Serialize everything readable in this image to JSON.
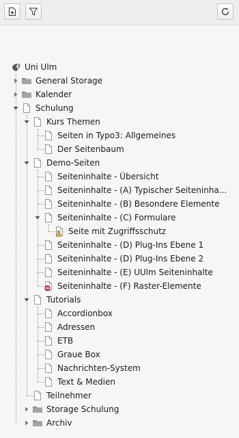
{
  "toolbar": {
    "new_page": {
      "icon": "new-page-icon"
    },
    "filter": {
      "icon": "filter-icon"
    },
    "refresh": {
      "icon": "refresh-icon"
    }
  },
  "tree": {
    "root": {
      "label": "Uni Ulm",
      "icon": "typo3-logo-icon"
    },
    "general_storage": {
      "label": "General Storage",
      "icon": "folder-icon",
      "state": "collapsed"
    },
    "kalender": {
      "label": "Kalender",
      "icon": "folder-icon",
      "state": "collapsed"
    },
    "schulung": {
      "label": "Schulung",
      "icon": "page-icon",
      "state": "expanded"
    },
    "kurs_themen": {
      "label": "Kurs Themen",
      "icon": "page-icon",
      "state": "expanded"
    },
    "seiten_typo3": {
      "label": "Seiten in Typo3: Allgemeines",
      "icon": "page-icon"
    },
    "seitenbaum": {
      "label": "Der Seitenbaum",
      "icon": "page-icon"
    },
    "demo_seiten": {
      "label": "Demo-Seiten",
      "icon": "page-icon",
      "state": "expanded"
    },
    "si_uebersicht": {
      "label": "Seiteninhalte - Übersicht",
      "icon": "page-icon"
    },
    "si_a": {
      "label": "Seiteninhalte - (A) Typischer Seiteninha...",
      "icon": "page-icon"
    },
    "si_b": {
      "label": "Seiteninhalte - (B) Besondere Elemente",
      "icon": "page-icon"
    },
    "si_c": {
      "label": "Seiteninhalte - (C) Formulare",
      "icon": "page-icon",
      "state": "expanded"
    },
    "zugriffsschutz": {
      "label": "Seite mit Zugriffsschutz",
      "icon": "protected-page-icon"
    },
    "si_d1": {
      "label": "Seiteninhalte - (D) Plug-Ins Ebene 1",
      "icon": "page-icon"
    },
    "si_d2": {
      "label": "Seiteninhalte - (D) Plug-Ins Ebene 2",
      "icon": "page-icon"
    },
    "si_e": {
      "label": "Seiteninhalte - (E) UUlm Seiteninhalte",
      "icon": "page-icon"
    },
    "si_f": {
      "label": "Seiteninhalte - (F) Raster-Elemente",
      "icon": "hidden-page-icon"
    },
    "tutorials": {
      "label": "Tutorials",
      "icon": "page-icon",
      "state": "expanded"
    },
    "accordionbox": {
      "label": "Accordionbox",
      "icon": "page-icon"
    },
    "adressen": {
      "label": "Adressen",
      "icon": "page-icon"
    },
    "etb": {
      "label": "ETB",
      "icon": "page-icon"
    },
    "graue_box": {
      "label": "Graue Box",
      "icon": "page-icon"
    },
    "nachrichten": {
      "label": "Nachrichten-System",
      "icon": "page-icon"
    },
    "text_medien": {
      "label": "Text & Medien",
      "icon": "page-icon"
    },
    "teilnehmer": {
      "label": "Teilnehmer",
      "icon": "page-icon"
    },
    "storage_schulung": {
      "label": "Storage Schulung",
      "icon": "folder-icon",
      "state": "collapsed"
    },
    "archiv": {
      "label": "Archiv",
      "icon": "folder-icon",
      "state": "collapsed"
    }
  },
  "colors": {
    "typo3_logo": "#5a5a5a",
    "hidden_badge": "#c83c3c",
    "protected_badge": "#d6b24a"
  }
}
